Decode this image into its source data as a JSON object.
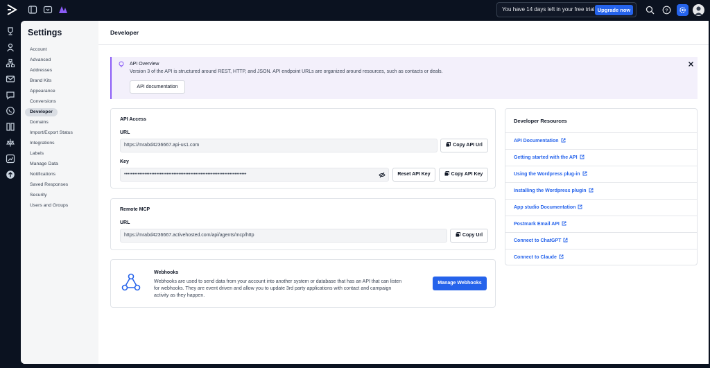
{
  "topbar": {
    "logo_icon": "activecampaign-logo-icon",
    "icons": [
      "sidebar-toggle-icon",
      "inbox-icon",
      "apps-icon"
    ],
    "trial_text": "You have 14 days left in your free trial.",
    "upgrade_label": "Upgrade now",
    "right_icons": [
      "search-icon",
      "help-icon",
      "gear-icon",
      "avatar-icon"
    ]
  },
  "rail": {
    "icons": [
      "trophy-icon",
      "contacts-icon",
      "automations-icon",
      "email-icon",
      "conversations-icon",
      "whatsapp-icon",
      "pages-icon",
      "deals-icon",
      "reports-icon",
      "upload-icon"
    ]
  },
  "settings": {
    "title": "Settings",
    "items": [
      "Account",
      "Advanced",
      "Addresses",
      "Brand Kits",
      "Appearance",
      "Conversions",
      "Developer",
      "Domains",
      "Import/Export Status",
      "Integrations",
      "Labels",
      "Manage Data",
      "Notifications",
      "Saved Responses",
      "Security",
      "Users and Groups"
    ],
    "active": "Developer"
  },
  "page": {
    "title": "Developer"
  },
  "banner": {
    "title": "API Overview",
    "text": "Version 3 of the API is structured around REST, HTTP, and JSON. API endpoint URLs are organized around resources, such as contacts or deals.",
    "button": "API documentation"
  },
  "api_access": {
    "title": "API Access",
    "url_label": "URL",
    "url_value": "https://mrabd4236667.api-us1.com",
    "copy_url_label": "Copy API Url",
    "key_label": "Key",
    "key_value": "••••••••••••••••••••••••••••••••••••••••••••••••••••••••••••••••••••••••",
    "reset_label": "Reset API Key",
    "copy_key_label": "Copy API Key"
  },
  "remote_mcp": {
    "title": "Remote MCP",
    "url_label": "URL",
    "url_value": "https://mrabd4236667.activehosted.com/api/agents/mcp/http",
    "copy_label": "Copy Url"
  },
  "webhooks": {
    "title": "Webhooks",
    "lines": [
      "Webhooks are used to send data from your account into another system or database that has an API that can listen",
      "for webhooks. They are event driven and allow you to update 3rd party applications with contact and campaign",
      "activity as they happen."
    ],
    "button": "Manage Webhooks"
  },
  "resources": {
    "title": "Developer Resources",
    "links": [
      "API Documentation",
      "Getting started with the API",
      "Using the Wordpress plug-in",
      "Installing the Wordpress plugin",
      "App studio Documentation",
      "Postmark Email API",
      "Connect to ChatGPT",
      "Connect to Claude"
    ]
  },
  "colors": {
    "accent": "#2563eb",
    "banner_bg": "#f3f0fb",
    "banner_border": "#8b5cf6",
    "dark": "#0b1220"
  }
}
